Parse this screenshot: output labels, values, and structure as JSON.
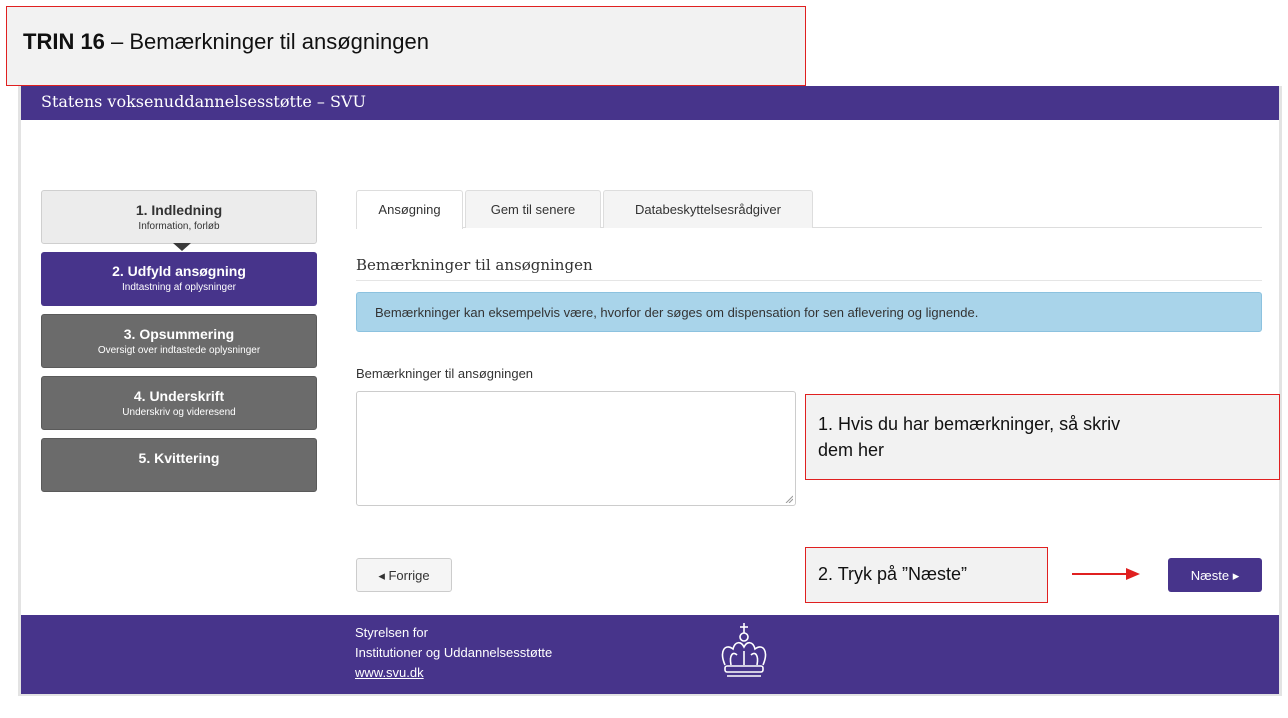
{
  "instruction": {
    "step_label": "TRIN 16",
    "step_title": " – Bemærkninger til ansøgningen"
  },
  "header": {
    "title": "Statens voksenuddannelsesstøtte – SVU"
  },
  "stepper": [
    {
      "title": "1. Indledning",
      "sub": "Information, forløb"
    },
    {
      "title": "2. Udfyld ansøgning",
      "sub": "Indtastning af oplysninger"
    },
    {
      "title": "3. Opsummering",
      "sub": "Oversigt over indtastede oplysninger"
    },
    {
      "title": "4. Underskrift",
      "sub": "Underskriv og videresend"
    },
    {
      "title": "5. Kvittering",
      "sub": ""
    }
  ],
  "tabs": [
    {
      "label": "Ansøgning"
    },
    {
      "label": "Gem til senere"
    },
    {
      "label": "Databeskyttelsesrådgiver"
    }
  ],
  "main": {
    "section_title": "Bemærkninger til ansøgningen",
    "info": "Bemærkninger kan eksempelvis være, hvorfor der søges om dispensation for sen aflevering og lignende.",
    "field_label": "Bemærkninger til ansøgningen",
    "textarea_value": ""
  },
  "buttons": {
    "prev": "Forrige",
    "next": "Næste"
  },
  "footer": {
    "line1": "Styrelsen for",
    "line2": "Institutioner og Uddannelsesstøtte",
    "link": "www.svu.dk"
  },
  "callouts": {
    "c1_line1": "1. Hvis du har bemærkninger, så skriv",
    "c1_line2": "dem her",
    "c2": "2. Tryk på ”Næste”"
  },
  "colors": {
    "brand_purple": "#47348b",
    "step_inactive": "#6b6b6b",
    "info_bg": "#a9d4ea",
    "callout_border": "#e02020"
  }
}
